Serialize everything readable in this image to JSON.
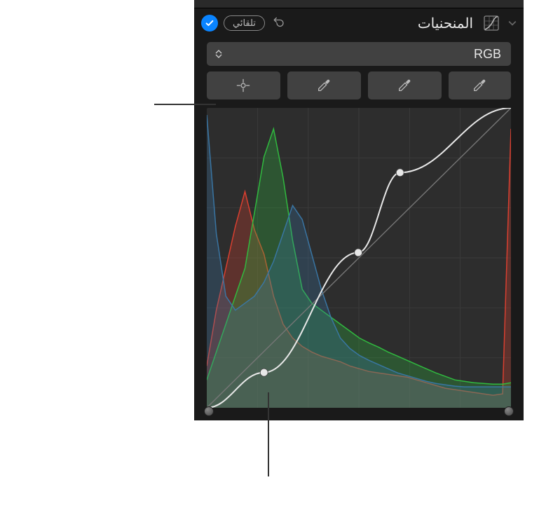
{
  "header": {
    "title": "المنحنيات",
    "auto_label": "تلقائي"
  },
  "channel": {
    "label": "RGB"
  },
  "chart_data": {
    "type": "line",
    "title": "",
    "xlabel": "",
    "ylabel": "",
    "xlim": [
      0,
      255
    ],
    "ylim": [
      0,
      255
    ],
    "curve_points": [
      {
        "x": 0,
        "y": 0
      },
      {
        "x": 48,
        "y": 30
      },
      {
        "x": 127,
        "y": 132
      },
      {
        "x": 162,
        "y": 200
      },
      {
        "x": 255,
        "y": 255
      }
    ],
    "histogram": {
      "x": [
        0,
        8,
        16,
        24,
        32,
        40,
        48,
        56,
        64,
        72,
        80,
        88,
        96,
        104,
        112,
        120,
        128,
        136,
        144,
        152,
        160,
        168,
        176,
        184,
        192,
        200,
        208,
        216,
        224,
        232,
        240,
        248,
        255
      ],
      "series": [
        {
          "name": "R",
          "color": "#e04030",
          "values": [
            60,
            140,
            200,
            260,
            310,
            255,
            220,
            160,
            120,
            100,
            88,
            80,
            74,
            70,
            66,
            60,
            56,
            52,
            50,
            48,
            46,
            44,
            40,
            36,
            32,
            28,
            26,
            24,
            22,
            20,
            18,
            20,
            400
          ]
        },
        {
          "name": "G",
          "color": "#30c040",
          "values": [
            40,
            80,
            120,
            160,
            200,
            280,
            360,
            400,
            330,
            240,
            170,
            150,
            140,
            130,
            120,
            110,
            100,
            93,
            87,
            80,
            74,
            68,
            62,
            56,
            50,
            45,
            40,
            38,
            36,
            35,
            34,
            34,
            36
          ]
        },
        {
          "name": "B",
          "color": "#3a78a8",
          "values": [
            420,
            250,
            160,
            140,
            150,
            160,
            180,
            210,
            250,
            290,
            270,
            220,
            170,
            130,
            100,
            85,
            75,
            68,
            62,
            56,
            50,
            46,
            42,
            38,
            35,
            33,
            31,
            30,
            30,
            30,
            30,
            30,
            30
          ]
        }
      ]
    },
    "black_point": 0,
    "white_point": 255
  }
}
